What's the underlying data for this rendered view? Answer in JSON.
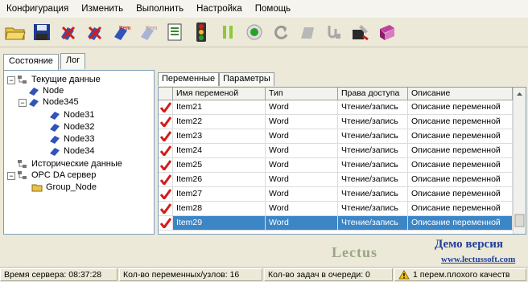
{
  "menu": [
    "Конфигурация",
    "Изменить",
    "Выполнить",
    "Настройка",
    "Помощь"
  ],
  "toolbar": {
    "icons": [
      "open-folder-icon",
      "save-icon",
      "delete-node-icon",
      "delete-item-icon",
      "add-item-icon",
      "add-item-disabled-icon",
      "document-icon",
      "traffic-light-icon",
      "pause-icon",
      "record-icon",
      "refresh-icon",
      "shape-icon",
      "connect-icon",
      "tools-icon",
      "book-icon"
    ]
  },
  "left_tabs": [
    "Состояние",
    "Лог"
  ],
  "tree": {
    "root_current": "Текущие данные",
    "node": "Node",
    "node345": "Node345",
    "children": [
      "Node31",
      "Node32",
      "Node33",
      "Node34"
    ],
    "historical": "Исторические данные",
    "opc": "OPC DA сервер",
    "group": "Group_Node"
  },
  "right_tabs": [
    "Переменные",
    "Параметры"
  ],
  "table": {
    "headers": [
      "Имя переменой",
      "Тип",
      "Права доступа",
      "Описание"
    ],
    "rows": [
      {
        "name": "Item21",
        "type": "Word",
        "access": "Чтение/запись",
        "desc": "Описание переменной"
      },
      {
        "name": "Item22",
        "type": "Word",
        "access": "Чтение/запись",
        "desc": "Описание переменной"
      },
      {
        "name": "Item23",
        "type": "Word",
        "access": "Чтение/запись",
        "desc": "Описание переменной"
      },
      {
        "name": "Item24",
        "type": "Word",
        "access": "Чтение/запись",
        "desc": "Описание переменной"
      },
      {
        "name": "Item25",
        "type": "Word",
        "access": "Чтение/запись",
        "desc": "Описание переменной"
      },
      {
        "name": "Item26",
        "type": "Word",
        "access": "Чтение/запись",
        "desc": "Описание переменной"
      },
      {
        "name": "Item27",
        "type": "Word",
        "access": "Чтение/запись",
        "desc": "Описание переменной"
      },
      {
        "name": "Item28",
        "type": "Word",
        "access": "Чтение/запись",
        "desc": "Описание переменной"
      },
      {
        "name": "Item29",
        "type": "Word",
        "access": "Чтение/запись",
        "desc": "Описание переменной"
      }
    ],
    "selected_row": "Item29"
  },
  "branding": {
    "logo": "Lectus",
    "demo": "Демо версия",
    "url": "www.lectussoft.com"
  },
  "status": {
    "server_time": "Время сервера: 08:37:28",
    "vars_nodes": "Кол-во переменных/узлов: 16",
    "queue": "Кол-во задач в очереди: 0",
    "bad_quality": "1 перем.плохого качеств"
  },
  "colors": {
    "selection": "#3d86c6",
    "check": "#d21c1c",
    "brand_blue": "#1f3e9c"
  }
}
